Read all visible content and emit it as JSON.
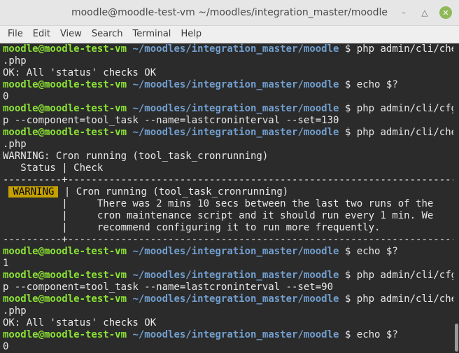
{
  "window": {
    "title": "moodle@moodle-test-vm ~/moodles/integration_master/moodle",
    "minimize_glyph": "–",
    "maximize_glyph": "△",
    "close_glyph": "✕"
  },
  "menu": [
    "File",
    "Edit",
    "View",
    "Search",
    "Terminal",
    "Help"
  ],
  "prompt": {
    "user": "moodle@moodle-test-vm",
    "path": "~/moodles/integration_master/moodle",
    "symbol": "$"
  },
  "terminal": {
    "cmd1a": " php admin/cli/checks",
    "cmd1b": ".php",
    "out1": "OK: All 'status' checks OK",
    "cmd2": " echo $?",
    "out2": "0",
    "cmd3a": " php admin/cli/cfg.ph",
    "cmd3b": "p --component=tool_task --name=lastcroninterval --set=130",
    "cmd4a": " php admin/cli/checks",
    "cmd4b": ".php",
    "out4a": "WARNING: Cron running (tool_task_cronrunning)",
    "out4b": "   Status | Check",
    "out4c": "----------+------------------------------------------------------------------",
    "badge": "WARNING",
    "out4d_pre": " ",
    "out4d_post": " | Cron running (tool_task_cronrunning)",
    "out4e": "          |     There was 2 mins 10 secs between the last two runs of the",
    "out4f": "          |     cron maintenance script and it should run every 1 min. We",
    "out4g": "          |     recommend configuring it to run more frequently.",
    "out4h": "----------+------------------------------------------------------------------",
    "cmd5": " echo $?",
    "out5": "1",
    "cmd6a": " php admin/cli/cfg.ph",
    "cmd6b": "p --component=tool_task --name=lastcroninterval --set=90",
    "cmd7a": " php admin/cli/checks",
    "cmd7b": ".php",
    "out7": "OK: All 'status' checks OK",
    "cmd8": " echo $?",
    "out8": "0"
  }
}
